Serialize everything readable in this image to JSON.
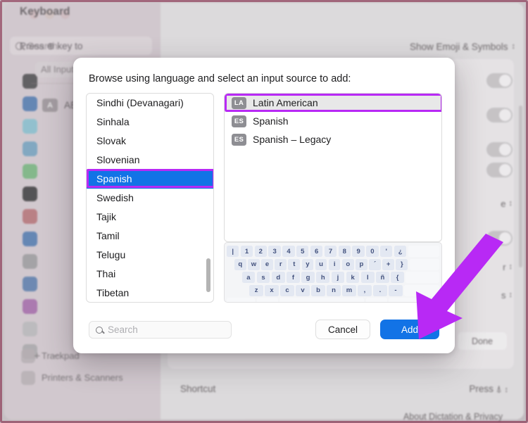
{
  "window": {
    "title": "Keyboard",
    "sidebar_search_placeholder": "Search",
    "sidebar_items": [
      {
        "label": "Trackpad",
        "icon": "trackpad-icon"
      },
      {
        "label": "Printers & Scanners",
        "icon": "printer-icon"
      }
    ],
    "icon_colors": [
      "#4a4a4f",
      "#2f7de1",
      "#5ec8e6",
      "#4fa8dd",
      "#4cc35e",
      "#39393d",
      "#e0656d",
      "#2f7de1",
      "#9b9b9f",
      "#3f7fd6",
      "#c45bd0",
      "#b8b8bc",
      "#a8a8ac"
    ],
    "press_key_row": {
      "label": "Press ⊕ key to",
      "value": "Show Emoji & Symbols"
    },
    "shortcut_row": {
      "label": "Shortcut",
      "value": "Press ⍋"
    },
    "about_button": "About Dictation & Privacy",
    "done_button": "Done",
    "all_input_sources": "All Input Sources",
    "abc_item": {
      "badge": "A",
      "label": "ABC"
    },
    "add_symbol": "+",
    "remove_symbol": "−"
  },
  "dialog": {
    "prompt": "Browse using language and select an input source to add:",
    "languages": [
      "Sindhi (Devanagari)",
      "Sinhala",
      "Slovak",
      "Slovenian",
      "Spanish",
      "Swedish",
      "Tajik",
      "Tamil",
      "Telugu",
      "Thai",
      "Tibetan"
    ],
    "selected_language": "Spanish",
    "selected_language_index": 4,
    "input_sources": [
      {
        "badge": "LA",
        "label": "Latin American"
      },
      {
        "badge": "ES",
        "label": "Spanish"
      },
      {
        "badge": "ES",
        "label": "Spanish – Legacy"
      }
    ],
    "selected_source_index": 0,
    "search_placeholder": "Search",
    "search_value": "",
    "cancel_label": "Cancel",
    "add_label": "Add",
    "keyboard_rows": [
      [
        "|",
        "1",
        "2",
        "3",
        "4",
        "5",
        "6",
        "7",
        "8",
        "9",
        "0",
        "'",
        "¿"
      ],
      [
        "q",
        "w",
        "e",
        "r",
        "t",
        "y",
        "u",
        "i",
        "o",
        "p",
        "´",
        "+",
        "}"
      ],
      [
        "a",
        "s",
        "d",
        "f",
        "g",
        "h",
        "j",
        "k",
        "l",
        "ñ",
        "{"
      ],
      [
        "z",
        "x",
        "c",
        "v",
        "b",
        "n",
        "m",
        ",",
        ".",
        "-"
      ]
    ]
  },
  "annotation": {
    "highlight_color": "#b829f5",
    "selection_color": "#1273e6",
    "arrow_color": "#b829f5",
    "arrow_target": "Add"
  }
}
